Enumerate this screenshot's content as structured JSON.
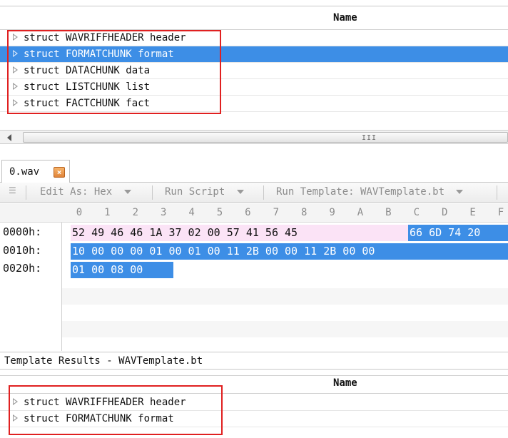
{
  "tree_top": {
    "column_header": "Name",
    "items": [
      {
        "label": "struct WAVRIFFHEADER header",
        "selected": false
      },
      {
        "label": "struct FORMATCHUNK format",
        "selected": true
      },
      {
        "label": "struct DATACHUNK data",
        "selected": false
      },
      {
        "label": "struct LISTCHUNK list",
        "selected": false
      },
      {
        "label": "struct FACTCHUNK fact",
        "selected": false
      }
    ]
  },
  "scrollbar": {
    "grip": "III"
  },
  "tab": {
    "label": "0.wav",
    "close_icon": "close-icon"
  },
  "toolbar": {
    "edit_as": "Edit As: Hex",
    "run_script": "Run Script",
    "run_template": "Run Template: WAVTemplate.bt"
  },
  "hex_columns": [
    "0",
    "1",
    "2",
    "3",
    "4",
    "5",
    "6",
    "7",
    "8",
    "9",
    "A",
    "B",
    "C",
    "D",
    "E",
    "F"
  ],
  "hex_rows": [
    {
      "address": "0000h:",
      "bytes": "52 49 46 46 1A 37 02 00 57 41 56 45",
      "bytes_sel": "66 6D 74 20"
    },
    {
      "address": "0010h:",
      "bytes": "",
      "bytes_sel": "10 00 00 00 01 00 01 00 11 2B 00 00 11 2B 00 00"
    },
    {
      "address": "0020h:",
      "bytes": "",
      "bytes_sel": "01 00 08 00"
    }
  ],
  "status_text": "Template Results - WAVTemplate.bt",
  "tree_bottom": {
    "column_header": "Name",
    "items": [
      {
        "label": "struct WAVRIFFHEADER header"
      },
      {
        "label": "struct FORMATCHUNK format"
      }
    ]
  },
  "colors": {
    "selection": "#3d8ee6",
    "header_highlight": "#fbe3f6",
    "annotation": "#e02020",
    "tab_close": "#e0843a"
  }
}
